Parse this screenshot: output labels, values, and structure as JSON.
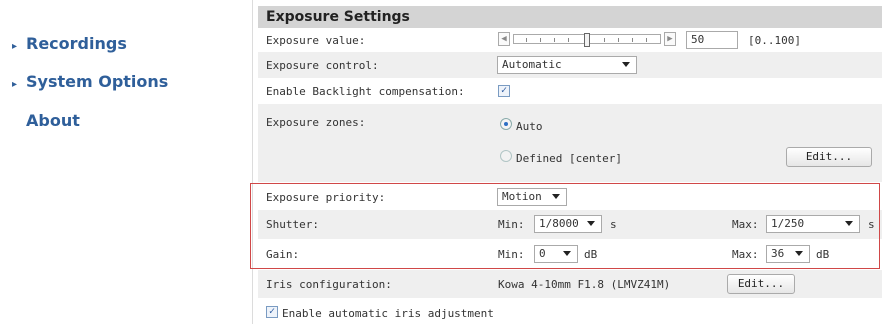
{
  "sidebar": {
    "items": [
      {
        "label": "Recordings",
        "arrow": true
      },
      {
        "label": "System Options",
        "arrow": true
      },
      {
        "label": "About",
        "arrow": false
      }
    ]
  },
  "panel": {
    "title": "Exposure Settings",
    "exposure_value": {
      "label": "Exposure value:",
      "value": "50",
      "range": "[0..100]",
      "slider_fraction": 0.5
    },
    "exposure_control": {
      "label": "Exposure control:",
      "value": "Automatic"
    },
    "backlight": {
      "label": "Enable Backlight compensation:",
      "checked": true
    },
    "exposure_zones": {
      "label": "Exposure zones:",
      "options": [
        {
          "label": "Auto",
          "selected": true
        },
        {
          "label": "Defined [center]",
          "selected": false
        }
      ],
      "edit_button": "Edit..."
    },
    "exposure_priority": {
      "label": "Exposure priority:",
      "value": "Motion"
    },
    "shutter": {
      "label": "Shutter:",
      "min_label": "Min:",
      "min_value": "1/8000",
      "min_unit": "s",
      "max_label": "Max:",
      "max_value": "1/250",
      "max_unit": "s"
    },
    "gain": {
      "label": "Gain:",
      "min_label": "Min:",
      "min_value": "0",
      "min_unit": "dB",
      "max_label": "Max:",
      "max_value": "36",
      "max_unit": "dB"
    },
    "iris": {
      "label": "Iris configuration:",
      "value": "Kowa 4-10mm F1.8 (LMVZ41M)",
      "edit_button": "Edit..."
    },
    "auto_iris": {
      "label": "Enable automatic iris adjustment",
      "checked": true
    }
  },
  "colors": {
    "nav": "#2f5f9a",
    "header_bg": "#d4d4d4",
    "row_gray": "#efefef",
    "highlight": "#d04848"
  }
}
